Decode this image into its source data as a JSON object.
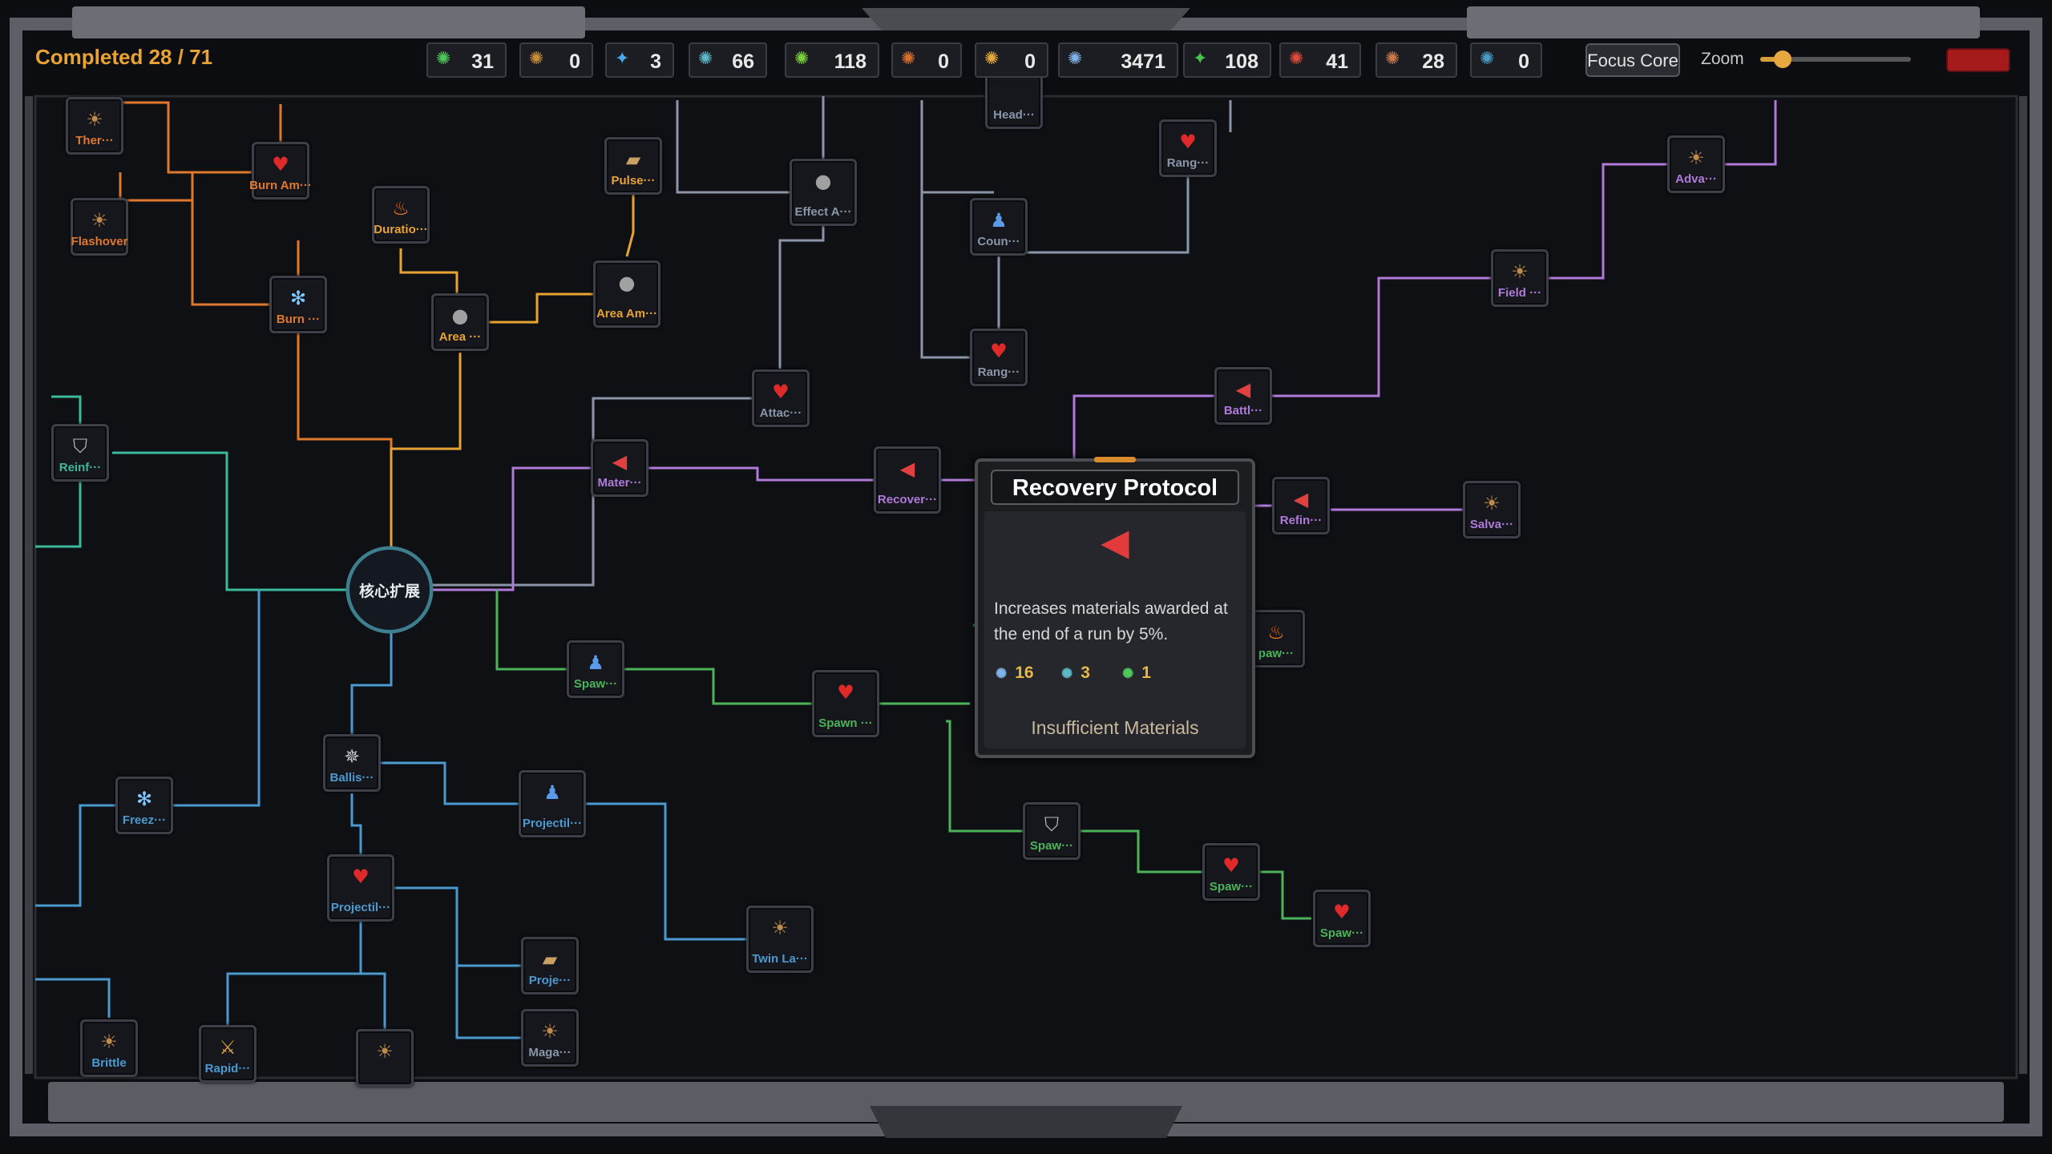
{
  "hud": {
    "completed": "Completed 28 / 71",
    "resources": [
      {
        "icon": "green-bug-icon",
        "glyph": "✺",
        "color": "#4fc85a",
        "value": "31"
      },
      {
        "icon": "brown-bug-icon",
        "glyph": "✺",
        "color": "#c98e3a",
        "value": "0"
      },
      {
        "icon": "blue-crystal-icon",
        "glyph": "✦",
        "color": "#4aa8e8",
        "value": "3"
      },
      {
        "icon": "teal-bug-icon",
        "glyph": "✺",
        "color": "#5bb8c8",
        "value": "66"
      },
      {
        "icon": "green-moss-icon",
        "glyph": "✺",
        "color": "#7ccf3c",
        "value": "118"
      },
      {
        "icon": "orange-bug-icon",
        "glyph": "✺",
        "color": "#d9702a",
        "value": "0"
      },
      {
        "icon": "gold-bug-icon",
        "glyph": "✺",
        "color": "#e3a93b",
        "value": "0"
      },
      {
        "icon": "blue-bug-icon",
        "glyph": "✺",
        "color": "#7fb4e8",
        "value": "3471"
      },
      {
        "icon": "green-shard-icon",
        "glyph": "✦",
        "color": "#45c44a",
        "value": "108"
      },
      {
        "icon": "red-bug-icon",
        "glyph": "✺",
        "color": "#e04a3a",
        "value": "41"
      },
      {
        "icon": "rust-bug-icon",
        "glyph": "✺",
        "color": "#c9794a",
        "value": "28"
      },
      {
        "icon": "cyan-bug-icon",
        "glyph": "✺",
        "color": "#4a9ec8",
        "value": "0"
      }
    ],
    "focus_label": "Focus Core",
    "zoom_label": "Zoom",
    "zoom_level": 0.15
  },
  "core": {
    "label": "核心扩展"
  },
  "colors": {
    "orange": "#e0782e",
    "amber": "#e8a332",
    "gray": "#8a96a8",
    "purple": "#b07ad8",
    "green": "#4cb35a",
    "teal": "#3cb89a",
    "blue": "#4a9ad0"
  },
  "nodes": [
    {
      "name": "Ther…",
      "label": "Ther···",
      "icon": "claw-icon",
      "glyph": "☀",
      "glyph_color": "#c08a4a",
      "color": "orange"
    },
    {
      "name": "Flashover",
      "label": "Flashover",
      "icon": "claw-icon",
      "glyph": "☀",
      "glyph_color": "#c08a4a",
      "color": "orange"
    },
    {
      "name": "Burn Am…",
      "label": "Burn Am···",
      "icon": "heart-icon",
      "glyph": "♥",
      "glyph_color": "#e02a2a",
      "color": "orange"
    },
    {
      "name": "Burn…",
      "label": "Burn ···",
      "icon": "snowflake-icon",
      "glyph": "✻",
      "glyph_color": "#7cc8ff",
      "color": "orange"
    },
    {
      "name": "Duratio…",
      "label": "Duratio···",
      "icon": "fire-icon",
      "glyph": "♨",
      "glyph_color": "#ff7a1a",
      "color": "amber"
    },
    {
      "name": "Area…",
      "label": "Area ···",
      "icon": "bomb-icon",
      "glyph": "●",
      "glyph_color": "#a0a0a0",
      "color": "amber"
    },
    {
      "name": "Area Am…",
      "label": "Area Am···",
      "icon": "bomb-icon",
      "glyph": "●",
      "glyph_color": "#a0a0a0",
      "color": "amber"
    },
    {
      "name": "Pulse…",
      "label": "Pulse···",
      "icon": "gun-icon",
      "glyph": "▰",
      "glyph_color": "#c9a062",
      "color": "amber"
    },
    {
      "name": "Effect A…",
      "label": "Effect A···",
      "icon": "bomb-icon",
      "glyph": "●",
      "glyph_color": "#a0a0a0",
      "color": "gray"
    },
    {
      "name": "Head…",
      "label": "Head···",
      "icon": "none",
      "glyph": "",
      "glyph_color": "#a0a0a0",
      "color": "gray"
    },
    {
      "name": "Coun…",
      "label": "Coun···",
      "icon": "soldier-icon",
      "glyph": "♟",
      "glyph_color": "#5a9ae8",
      "color": "gray"
    },
    {
      "name": "Rang… (top)",
      "label": "Rang···",
      "icon": "heart-icon",
      "glyph": "♥",
      "glyph_color": "#e02a2a",
      "color": "gray"
    },
    {
      "name": "Rang… (mid)",
      "label": "Rang···",
      "icon": "heart-icon",
      "glyph": "♥",
      "glyph_color": "#e02a2a",
      "color": "gray"
    },
    {
      "name": "Attac…",
      "label": "Attac···",
      "icon": "heart-icon",
      "glyph": "♥",
      "glyph_color": "#e02a2a",
      "color": "gray"
    },
    {
      "name": "Mater…",
      "label": "Mater···",
      "icon": "megaphone-icon",
      "glyph": "◀",
      "glyph_color": "#e04040",
      "color": "purple"
    },
    {
      "name": "Recover…",
      "label": "Recover···",
      "icon": "megaphone-icon",
      "glyph": "◀",
      "glyph_color": "#e04040",
      "color": "purple"
    },
    {
      "name": "Battl…",
      "label": "Battl···",
      "icon": "megaphone-icon",
      "glyph": "◀",
      "glyph_color": "#e04040",
      "color": "purple"
    },
    {
      "name": "Field…",
      "label": "Field ···",
      "icon": "claw-icon",
      "glyph": "☀",
      "glyph_color": "#c08a4a",
      "color": "purple"
    },
    {
      "name": "Adva…",
      "label": "Adva···",
      "icon": "claw-icon",
      "glyph": "☀",
      "glyph_color": "#c08a4a",
      "color": "purple"
    },
    {
      "name": "Refin…",
      "label": "Refin···",
      "icon": "megaphone-icon",
      "glyph": "◀",
      "glyph_color": "#e04040",
      "color": "purple"
    },
    {
      "name": "Salva…",
      "label": "Salva···",
      "icon": "claw-icon",
      "glyph": "☀",
      "glyph_color": "#c08a4a",
      "color": "purple"
    },
    {
      "name": "Reinf…",
      "label": "Reinf···",
      "icon": "shield-icon",
      "glyph": "⛉",
      "glyph_color": "#b8b8b8",
      "color": "teal"
    },
    {
      "name": "Spaw… (a)",
      "label": "Spaw···",
      "icon": "soldier-icon",
      "glyph": "♟",
      "glyph_color": "#5a9ae8",
      "color": "green"
    },
    {
      "name": "Spawn…",
      "label": "Spawn ···",
      "icon": "heart-icon",
      "glyph": "♥",
      "glyph_color": "#e02a2a",
      "color": "green"
    },
    {
      "name": "paw… (partial)",
      "label": "paw···",
      "icon": "fire-icon",
      "glyph": "♨",
      "glyph_color": "#ff7a1a",
      "color": "green"
    },
    {
      "name": "Spaw… (b)",
      "label": "Spaw···",
      "icon": "shield-icon",
      "glyph": "⛉",
      "glyph_color": "#b8b8b8",
      "color": "green"
    },
    {
      "name": "Spaw… (c)",
      "label": "Spaw···",
      "icon": "heart-icon",
      "glyph": "♥",
      "glyph_color": "#e02a2a",
      "color": "green"
    },
    {
      "name": "Spaw… (d)",
      "label": "Spaw···",
      "icon": "heart-icon",
      "glyph": "♥",
      "glyph_color": "#e02a2a",
      "color": "green"
    },
    {
      "name": "Ballis…",
      "label": "Ballis···",
      "icon": "spider-icon",
      "glyph": "✵",
      "glyph_color": "#c8c8c8",
      "color": "blue"
    },
    {
      "name": "Freez…",
      "label": "Freez···",
      "icon": "snowflake-icon",
      "glyph": "✻",
      "glyph_color": "#7cc8ff",
      "color": "blue"
    },
    {
      "name": "Projectil… (a)",
      "label": "Projectil···",
      "icon": "soldier-icon",
      "glyph": "♟",
      "glyph_color": "#5a9ae8",
      "color": "blue"
    },
    {
      "name": "Projectil… (b)",
      "label": "Projectil···",
      "icon": "heart-icon",
      "glyph": "♥",
      "glyph_color": "#e02a2a",
      "color": "blue"
    },
    {
      "name": "Twin La…",
      "label": "Twin La···",
      "icon": "claw-icon",
      "glyph": "☀",
      "glyph_color": "#c08a4a",
      "color": "blue"
    },
    {
      "name": "Proje…",
      "label": "Proje···",
      "icon": "gun-icon",
      "glyph": "▰",
      "glyph_color": "#c9a062",
      "color": "blue"
    },
    {
      "name": "Maga…",
      "label": "Maga···",
      "icon": "claw-icon",
      "glyph": "☀",
      "glyph_color": "#c08a4a",
      "color": "gray"
    },
    {
      "name": "Brittle",
      "label": "Brittle",
      "icon": "claw-icon",
      "glyph": "☀",
      "glyph_color": "#c08a4a",
      "color": "blue"
    },
    {
      "name": "Rapid…",
      "label": "Rapid···",
      "icon": "sword-icon",
      "glyph": "⚔",
      "glyph_color": "#e0a040",
      "color": "blue"
    },
    {
      "name": "(bottom unlabeled)",
      "label": "",
      "icon": "claw-icon",
      "glyph": "☀",
      "glyph_color": "#c08a4a",
      "color": "blue"
    }
  ],
  "tooltip": {
    "title": "Recovery Protocol",
    "icon": "megaphone-icon",
    "icon_glyph": "◀",
    "description": "Increases materials awarded at the end of a run by 5%.",
    "costs": [
      {
        "icon": "blue-bug-icon",
        "glyph": "✺",
        "color": "#7fb4e8",
        "value": "16"
      },
      {
        "icon": "teal-bug-icon",
        "glyph": "✺",
        "color": "#5bb8c8",
        "value": "3"
      },
      {
        "icon": "green-bug-icon",
        "glyph": "✺",
        "color": "#4fc85a",
        "value": "1"
      }
    ],
    "status": "Insufficient Materials"
  }
}
